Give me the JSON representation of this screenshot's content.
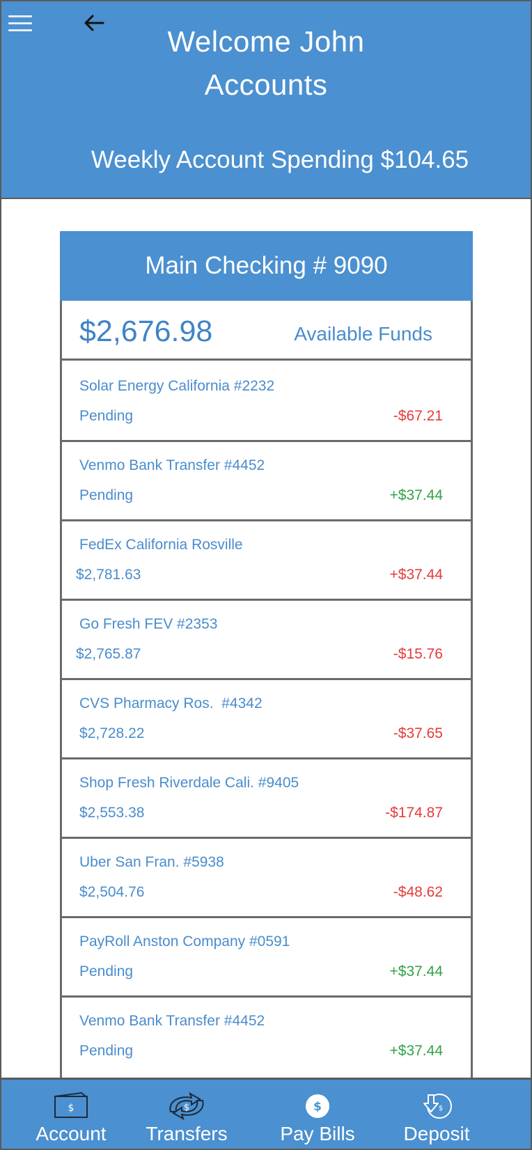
{
  "header": {
    "title_line1": "Welcome John",
    "title_line2": "Accounts",
    "weekly_spending": "Weekly Account Spending $104.65"
  },
  "account": {
    "title": "Main Checking # 9090",
    "balance": "$2,676.98",
    "balance_label": "Available Funds"
  },
  "transactions": [
    {
      "name": "Solar Energy California #2232",
      "sub": "Pending",
      "amount": "-$67.21",
      "sign": "neg"
    },
    {
      "name": "Venmo Bank Transfer #4452",
      "sub": "Pending",
      "amount": "+$37.44",
      "sign": "pos"
    },
    {
      "name": "FedEx California Rosville",
      "sub": "$2,781.63",
      "amount": "+$37.44",
      "sign": "neg"
    },
    {
      "name": "Go Fresh FEV #2353",
      "sub": "$2,765.87",
      "amount": "-$15.76",
      "sign": "neg"
    },
    {
      "name": "CVS Pharmacy Ros.  #4342",
      "sub": "$2,728.22",
      "amount": "-$37.65",
      "sign": "neg"
    },
    {
      "name": "Shop Fresh Riverdale Cali. #9405",
      "sub": "$2,553.38",
      "amount": "-$174.87",
      "sign": "neg"
    },
    {
      "name": "Uber San Fran. #5938",
      "sub": "$2,504.76",
      "amount": "-$48.62",
      "sign": "neg"
    },
    {
      "name": "PayRoll Anston Company #0591",
      "sub": "Pending",
      "amount": "+$37.44",
      "sign": "pos"
    },
    {
      "name": "Venmo Bank Transfer #4452",
      "sub": "Pending",
      "amount": "+$37.44",
      "sign": "pos"
    }
  ],
  "nav": {
    "account": "Account",
    "transfers": "Transfers",
    "pay_bills": "Pay Bills",
    "deposit": "Deposit"
  },
  "colors": {
    "primary": "#4b90d0",
    "text_blue": "#4a8ccc",
    "negative": "#e53a3a",
    "positive": "#2fa347"
  },
  "icons": {
    "menu": "hamburger-icon",
    "back": "arrow-left-icon",
    "account": "wallet-icon",
    "transfers": "transfer-arrows-icon",
    "pay_bills": "dollar-coin-icon",
    "deposit": "deposit-icon"
  }
}
